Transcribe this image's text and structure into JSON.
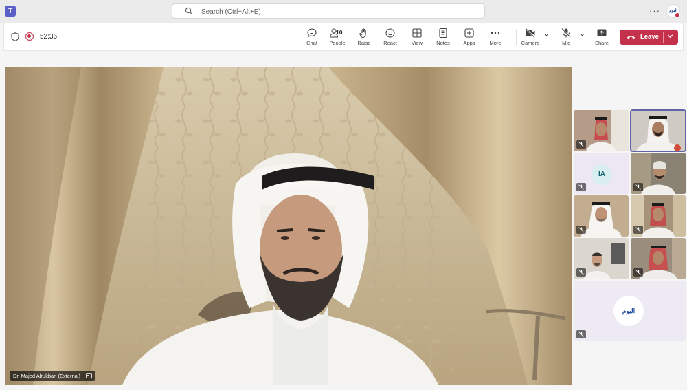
{
  "titlebar": {
    "search_placeholder": "Search (Ctrl+Alt+E)",
    "more_label": "···"
  },
  "toolbar": {
    "elapsed": "52:36",
    "buttons": {
      "chat": "Chat",
      "people": "People",
      "people_count": "10",
      "raise": "Raise",
      "react": "React",
      "view": "View",
      "notes": "Notes",
      "apps": "Apps",
      "more": "More",
      "camera": "Camera",
      "mic": "Mic",
      "share": "Share"
    },
    "leave_label": "Leave",
    "leave_color": "#c4314b"
  },
  "main_video": {
    "participant_name": "Dr. Majed Alrukban (External)"
  },
  "gallery": {
    "initials_tile": "IA",
    "brand_logo_text": "اليوم"
  },
  "colors": {
    "accent": "#6264a7",
    "record": "#c4314b"
  }
}
